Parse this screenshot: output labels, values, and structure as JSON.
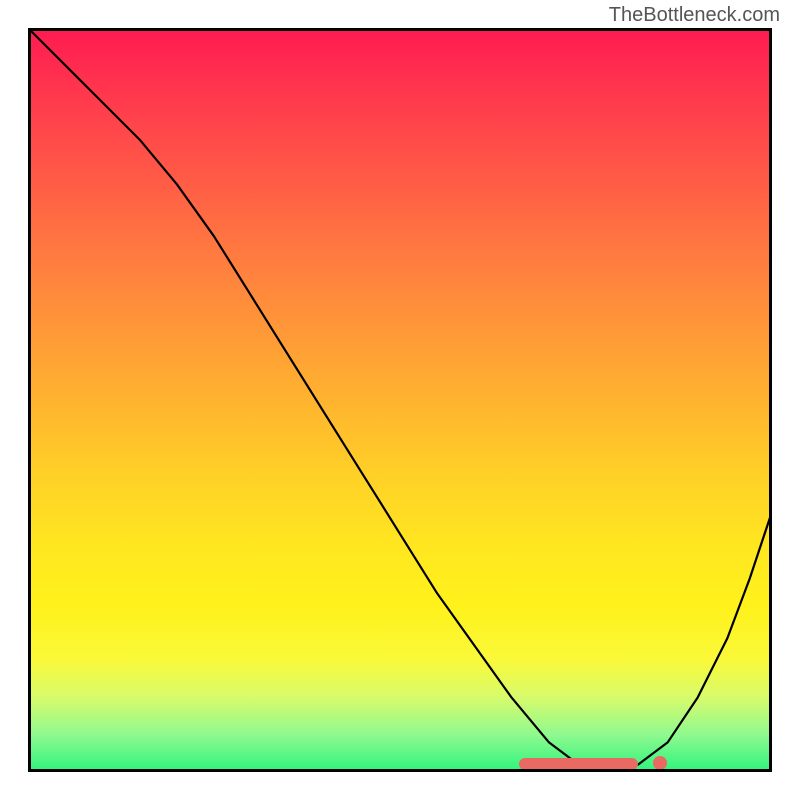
{
  "watermark": "TheBottleneck.com",
  "chart_data": {
    "type": "line",
    "title": "",
    "xlabel": "",
    "ylabel": "",
    "x": [
      0.0,
      0.05,
      0.1,
      0.15,
      0.2,
      0.25,
      0.3,
      0.35,
      0.4,
      0.45,
      0.5,
      0.55,
      0.6,
      0.65,
      0.7,
      0.74,
      0.78,
      0.82,
      0.86,
      0.9,
      0.94,
      0.97,
      1.0
    ],
    "values": [
      1.0,
      0.95,
      0.9,
      0.85,
      0.79,
      0.72,
      0.64,
      0.56,
      0.48,
      0.4,
      0.32,
      0.24,
      0.17,
      0.1,
      0.04,
      0.01,
      0.0,
      0.01,
      0.04,
      0.1,
      0.18,
      0.26,
      0.35
    ],
    "xlim": [
      0,
      1
    ],
    "ylim": [
      0,
      1
    ],
    "minimum_x": 0.78,
    "background_gradient": {
      "top": "#ff1a51",
      "upper_mid": "#ffb32f",
      "lower_mid": "#fff21c",
      "bottom": "#2cf47c"
    },
    "marker_range_x": [
      0.66,
      0.82
    ],
    "marker_point_x": 0.85
  }
}
